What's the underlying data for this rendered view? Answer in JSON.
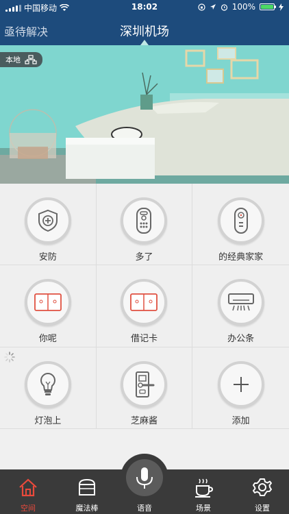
{
  "status_bar": {
    "carrier": "中国移动",
    "time": "18:02",
    "battery": "100%",
    "battery_level": 1.0,
    "battery_color": "#4cd964"
  },
  "nav": {
    "back_label": "亟待解决",
    "title": "深圳机场"
  },
  "hero": {
    "badge": "本地"
  },
  "devices": [
    {
      "label": "安防",
      "icon": "shield-plus-icon"
    },
    {
      "label": "多了",
      "icon": "remote-control-icon"
    },
    {
      "label": "的经典家家",
      "icon": "smart-remote-icon"
    },
    {
      "label": "你呢",
      "icon": "double-switch-icon"
    },
    {
      "label": "借记卡",
      "icon": "double-switch-icon"
    },
    {
      "label": "办公条",
      "icon": "air-conditioner-icon"
    },
    {
      "label": "灯泡上",
      "icon": "light-bulb-icon"
    },
    {
      "label": "芝麻酱",
      "icon": "door-lock-icon"
    },
    {
      "label": "添加",
      "icon": "add-icon"
    }
  ],
  "tabs": [
    {
      "label": "空间",
      "icon": "home-icon"
    },
    {
      "label": "魔法棒",
      "icon": "store-icon"
    },
    {
      "label": "语音",
      "icon": "microphone-icon"
    },
    {
      "label": "场景",
      "icon": "coffee-cup-icon"
    },
    {
      "label": "设置",
      "icon": "gear-icon"
    }
  ],
  "colors": {
    "nav_bg": "#1d4b7c",
    "accent": "#ea4a3c",
    "tab_bg": "#3a3a3a",
    "switch_red": "#e05040"
  }
}
